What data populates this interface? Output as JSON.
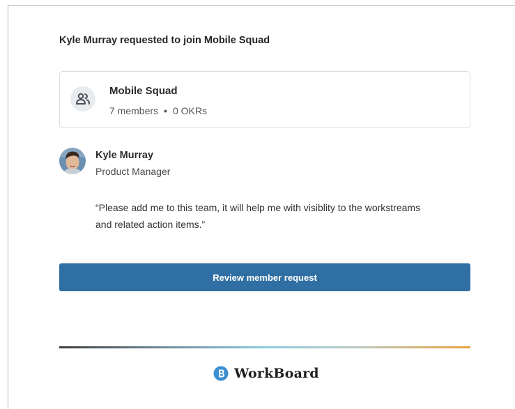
{
  "request": {
    "headline": "Kyle Murray requested to join Mobile Squad"
  },
  "team": {
    "icon": "team-icon",
    "name": "Mobile Squad",
    "members": "7 members",
    "separator": "•",
    "okrs": "0 OKRs"
  },
  "requester": {
    "name": "Kyle Murray",
    "role": "Product Manager",
    "message": "“Please add me to this team, it will help me with visiblity to the workstreams and related action items.”"
  },
  "actions": {
    "review_label": "Review member request"
  },
  "footer": {
    "brand_name": "WorkBoard",
    "brand_icon": "workboard-logo-icon"
  },
  "colors": {
    "button": "#2f6fa3",
    "brand": "#3b8fd0",
    "divider_start": "#3d3d3d",
    "divider_mid": "#8ccbe3",
    "divider_end": "#eaa23a"
  }
}
